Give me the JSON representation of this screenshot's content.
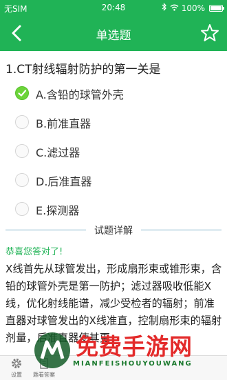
{
  "status_bar": {
    "carrier": "无SIM",
    "time": "20:48",
    "battery": "100%"
  },
  "nav": {
    "title": "单选题"
  },
  "question": {
    "text": "1.CT射线辐射防护的第一关是"
  },
  "options": [
    {
      "label": "A.含铅的球管外壳",
      "selected": true
    },
    {
      "label": "B.前准直器",
      "selected": false
    },
    {
      "label": "C.滤过器",
      "selected": false
    },
    {
      "label": "D.后准直器",
      "selected": false
    },
    {
      "label": "E.探测器",
      "selected": false
    }
  ],
  "detail": {
    "title": "试题详解",
    "correct_text": "恭喜您答对了!",
    "explanation": "X线首先从球管发出，形成扇形束或锥形束，含铅的球管外壳是第一防护；滤过器吸收低能X线，优化射线能谱，减少受检者的辐射；前准直器对球管发出的X线准直，控制扇形束的辐射剂量，后准直器使其更"
  },
  "tabbar": {
    "settings_label": "设置",
    "question_label": "题看答案"
  },
  "watermark": {
    "text": "免费手游网",
    "sub": "MIANFEISHOUYOUWANG"
  },
  "colors": {
    "primary": "#20b356",
    "check": "#6cd43a",
    "watermark_red": "#e32a2a"
  }
}
